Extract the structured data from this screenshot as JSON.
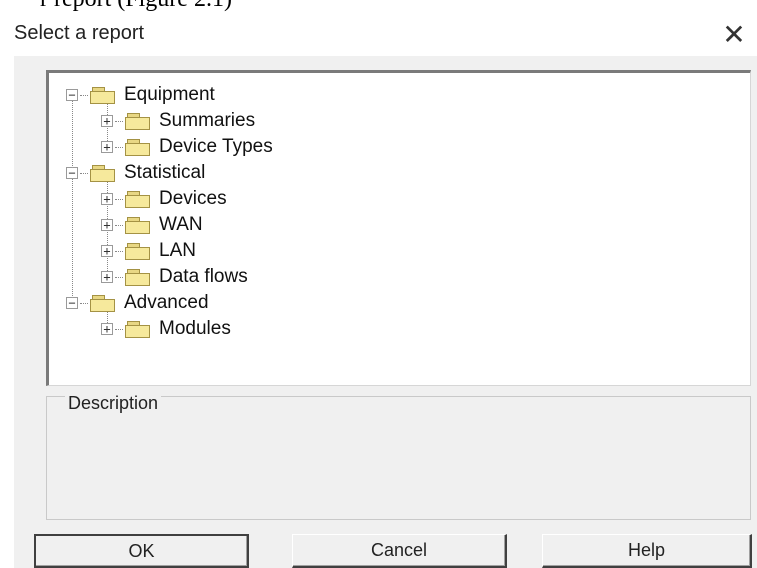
{
  "window": {
    "title": "Select a report",
    "close_glyph": "✕"
  },
  "tree": {
    "nodes": [
      {
        "label": "Equipment",
        "expander": "−",
        "icon": "folder-icon"
      },
      {
        "label": "Summaries",
        "expander": "+",
        "icon": "folder-icon"
      },
      {
        "label": "Device Types",
        "expander": "+",
        "icon": "folder-icon"
      },
      {
        "label": "Statistical",
        "expander": "−",
        "icon": "folder-icon"
      },
      {
        "label": "Devices",
        "expander": "+",
        "icon": "folder-icon"
      },
      {
        "label": "WAN",
        "expander": "+",
        "icon": "folder-icon"
      },
      {
        "label": "LAN",
        "expander": "+",
        "icon": "folder-icon"
      },
      {
        "label": "Data flows",
        "expander": "+",
        "icon": "folder-icon"
      },
      {
        "label": "Advanced",
        "expander": "−",
        "icon": "folder-icon"
      },
      {
        "label": "Modules",
        "expander": "+",
        "icon": "folder-icon"
      }
    ]
  },
  "description": {
    "legend": "Description",
    "text": ""
  },
  "buttons": {
    "ok": "OK",
    "cancel": "Cancel",
    "help": "Help"
  },
  "background_text": "r report (Figure 2.1)"
}
